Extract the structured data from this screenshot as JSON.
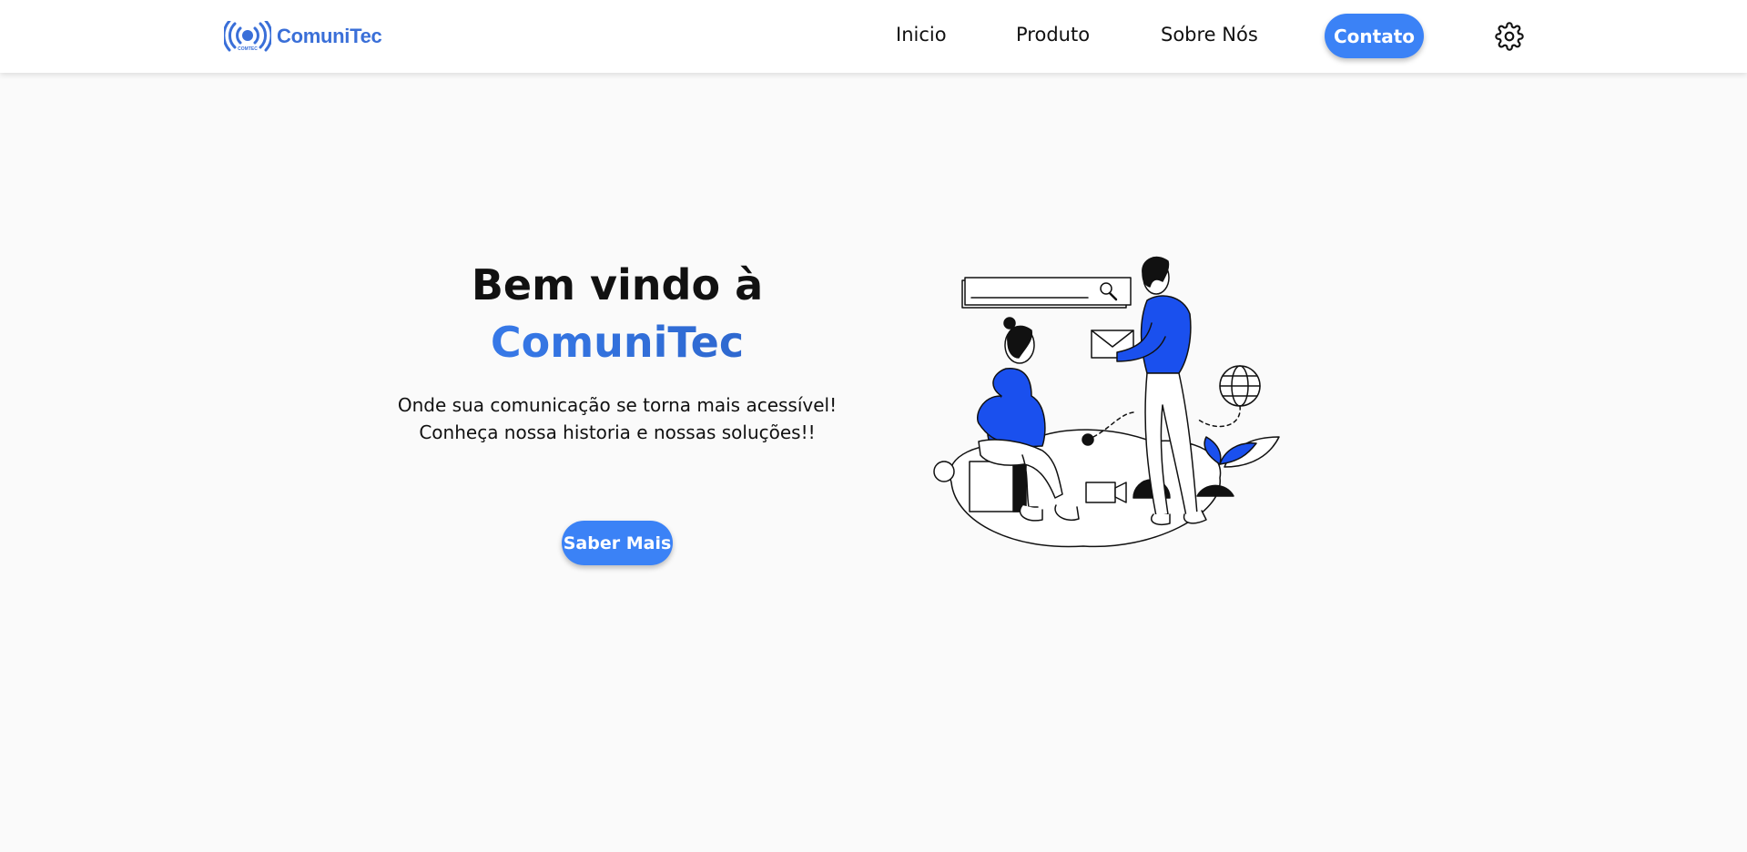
{
  "colors": {
    "accent": "#3b82f6",
    "accent_dark": "#2a5fc1",
    "logo_blue": "#3a6fd8",
    "illustration_blue": "#1a50ee"
  },
  "header": {
    "logo": {
      "icon": "broadcast-icon",
      "mark_text": "COMTEC",
      "text": "ComuniTec"
    },
    "nav": [
      {
        "label": "Inicio"
      },
      {
        "label": "Produto"
      },
      {
        "label": "Sobre Nós"
      }
    ],
    "contact_label": "Contato",
    "settings_icon": "gear-icon"
  },
  "hero": {
    "title_line1": "Bem vindo à",
    "title_line2": "ComuniTec",
    "subtitle_line1": "Onde sua comunicação se torna mais acessível!",
    "subtitle_line2": "Conheça nossa historia e nossas soluções!!",
    "cta_label": "Saber Mais"
  }
}
